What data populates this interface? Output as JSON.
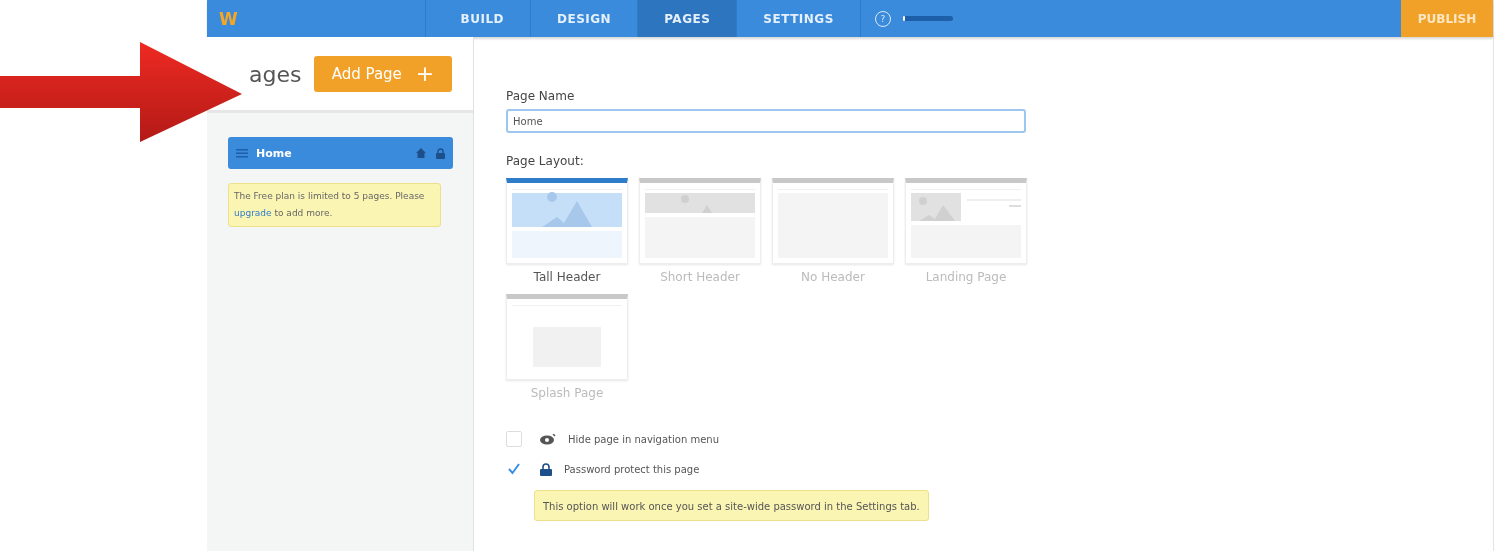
{
  "topbar": {
    "logo": "W",
    "tabs": [
      {
        "label": "BUILD",
        "selected": false
      },
      {
        "label": "DESIGN",
        "selected": false
      },
      {
        "label": "PAGES",
        "selected": true
      },
      {
        "label": "SETTINGS",
        "selected": false
      }
    ],
    "help": "?",
    "progress": {
      "level": 0.04
    },
    "publish": "PUBLISH"
  },
  "sidebar": {
    "title": "ages",
    "add_button": {
      "label": "Add Page",
      "icon": "+"
    },
    "pages": [
      {
        "label": "Home",
        "selected": true
      }
    ],
    "notice": {
      "text": "The Free plan is limited to 5 pages. Please",
      "link": "upgrade",
      "after": "to add more."
    }
  },
  "main": {
    "name_label": "Page Name",
    "name_value": "Home",
    "layout_label": "Page Layout:",
    "layouts": [
      {
        "label": "Tall Header",
        "kind": "tall",
        "selected": true
      },
      {
        "label": "Short Header",
        "kind": "short",
        "selected": false
      },
      {
        "label": "No Header",
        "kind": "none",
        "selected": false
      },
      {
        "label": "Landing Page",
        "kind": "landing",
        "selected": false
      },
      {
        "label": "Splash Page",
        "kind": "splash",
        "selected": false
      }
    ],
    "options": [
      {
        "label": "Hide page in navigation menu",
        "kind": "hide",
        "checked": false
      },
      {
        "label": "Password protect this page",
        "kind": "lock",
        "checked": true
      }
    ],
    "note": "This option will work once you set a site-wide password in the Settings tab."
  }
}
